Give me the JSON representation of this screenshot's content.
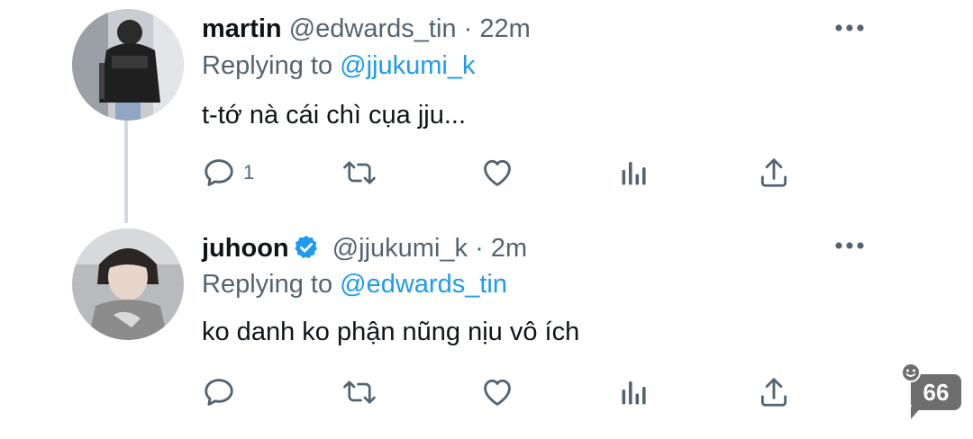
{
  "tweets": [
    {
      "name": "martin",
      "verified": false,
      "handle": "@edwards_tin",
      "separator": "·",
      "time": "22m",
      "replying_prefix": "Replying to",
      "replying_to": "@jjukumi_k",
      "text": "t-tớ nà cái chì cụa jju...",
      "reply_count": "1",
      "avatar_icon": "person-photo-dark-jacket"
    },
    {
      "name": "juhoon",
      "verified": true,
      "handle": "@jjukumi_k",
      "separator": "·",
      "time": "2m",
      "replying_prefix": "Replying to",
      "replying_to": "@edwards_tin",
      "text": "ko danh ko phận nũng nịu vô ích",
      "reply_count": "",
      "avatar_icon": "person-photo-grey-shirt"
    }
  ],
  "icons": {
    "reply": "reply-icon",
    "retweet": "retweet-icon",
    "like": "like-icon",
    "views": "views-icon",
    "share": "share-icon",
    "more": "more-icon",
    "verified": "verified-badge-icon"
  },
  "badge": {
    "value": "66",
    "icon": "smile-icon"
  },
  "colors": {
    "text_primary": "#0f1419",
    "text_secondary": "#536471",
    "link": "#1d9bf0",
    "thread_line": "#cfd9de",
    "badge_bg": "#6e6e6e"
  }
}
